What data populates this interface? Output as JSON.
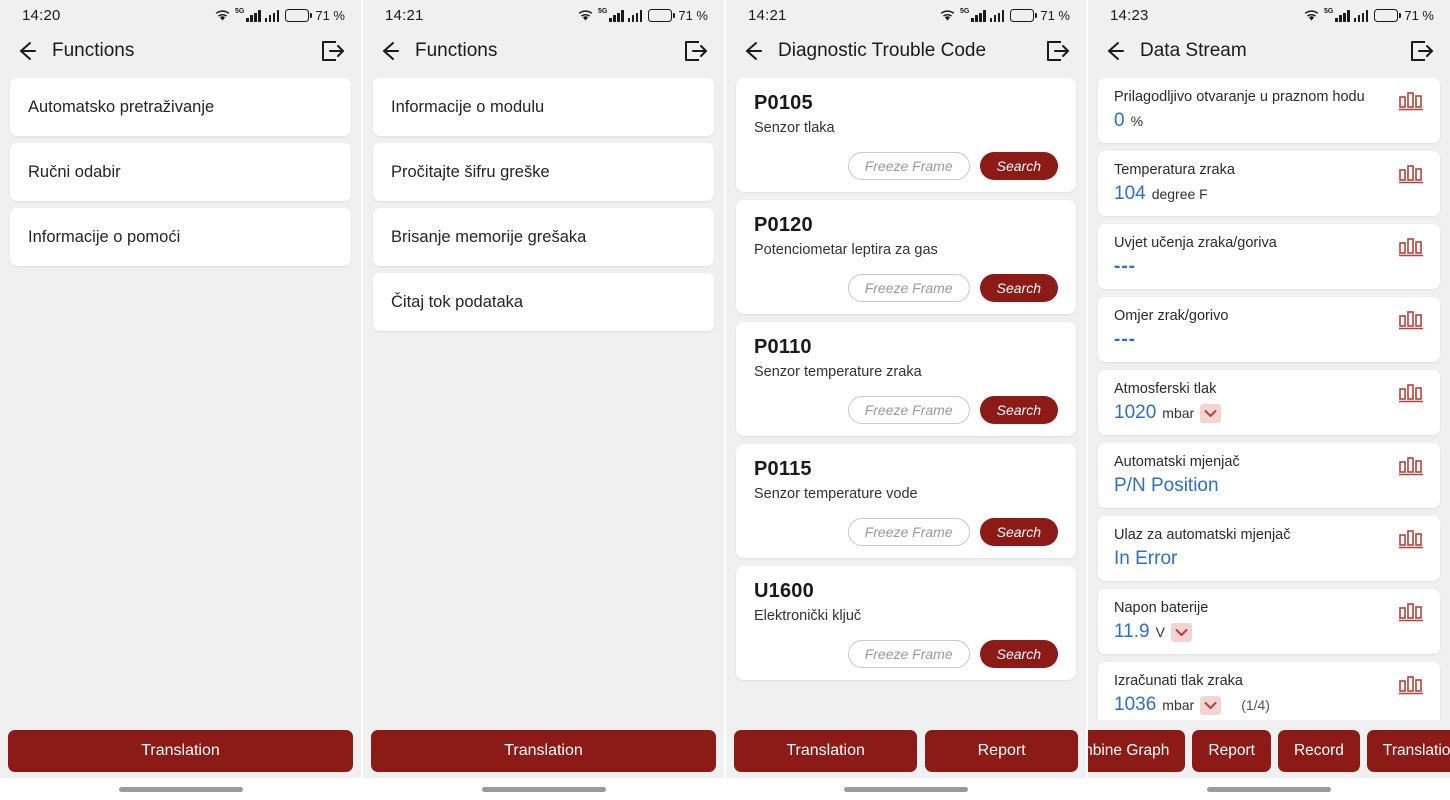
{
  "accent": {
    "red": "#8C1A17",
    "blue": "#2F6FC0",
    "chip_bg": "#F4D3D3",
    "card_bg": "#FFFFFF",
    "screen_bg": "#F0F0F0"
  },
  "panels": [
    {
      "status": {
        "time": "14:20",
        "battery": "71 %",
        "network": "5G"
      },
      "appbar": {
        "title": "Functions",
        "back_icon": "back-arrow-icon",
        "exit_icon": "exit-icon"
      },
      "items": [
        {
          "label": "Automatsko pretraživanje"
        },
        {
          "label": "Ručni odabir"
        },
        {
          "label": "Informacije o pomoći"
        }
      ],
      "buttons": [
        {
          "label": "Translation"
        }
      ]
    },
    {
      "status": {
        "time": "14:21",
        "battery": "71 %",
        "network": "5G"
      },
      "appbar": {
        "title": "Functions",
        "back_icon": "back-arrow-icon",
        "exit_icon": "exit-icon"
      },
      "items": [
        {
          "label": "Informacije o modulu"
        },
        {
          "label": "Pročitajte šifru greške"
        },
        {
          "label": "Brisanje memorije grešaka"
        },
        {
          "label": "Čitaj tok podataka"
        }
      ],
      "buttons": [
        {
          "label": "Translation"
        }
      ]
    },
    {
      "status": {
        "time": "14:21",
        "battery": "71 %",
        "network": "5G"
      },
      "appbar": {
        "title": "Diagnostic Trouble Code",
        "back_icon": "back-arrow-icon",
        "exit_icon": "exit-icon"
      },
      "freeze_label": "Freeze Frame",
      "search_label": "Search",
      "codes": [
        {
          "code": "P0105",
          "desc": "Senzor tlaka"
        },
        {
          "code": "P0120",
          "desc": "Potenciometar leptira za gas"
        },
        {
          "code": "P0110",
          "desc": "Senzor temperature zraka"
        },
        {
          "code": "P0115",
          "desc": "Senzor temperature vode"
        },
        {
          "code": "U1600",
          "desc": "Elektronički ključ"
        }
      ],
      "buttons": [
        {
          "label": "Translation"
        },
        {
          "label": "Report"
        }
      ]
    },
    {
      "status": {
        "time": "14:23",
        "battery": "71 %",
        "network": "5G"
      },
      "appbar": {
        "title": "Data Stream",
        "back_icon": "back-arrow-icon",
        "exit_icon": "exit-icon"
      },
      "page_indicator": "(1/4)",
      "streams": [
        {
          "label": "Prilagodljivo otvaranje u praznom hodu",
          "value": "0",
          "unit": "%",
          "chevron": false,
          "page": ""
        },
        {
          "label": "Temperatura zraka",
          "value": "104",
          "unit": "degree F",
          "chevron": false,
          "page": ""
        },
        {
          "label": "Uvjet učenja zraka/goriva",
          "value": "---",
          "unit": "",
          "chevron": false,
          "page": ""
        },
        {
          "label": "Omjer zrak/gorivo",
          "value": "---",
          "unit": "",
          "chevron": false,
          "page": ""
        },
        {
          "label": "Atmosferski tlak",
          "value": "1020",
          "unit": "mbar",
          "chevron": true,
          "page": ""
        },
        {
          "label": "Automatski mjenjač",
          "value": "P/N Position",
          "unit": "",
          "chevron": false,
          "page": ""
        },
        {
          "label": "Ulaz za automatski mjenjač",
          "value": "In Error",
          "unit": "",
          "chevron": false,
          "page": ""
        },
        {
          "label": "Napon baterije",
          "value": "11.9",
          "unit": "V",
          "chevron": true,
          "page": ""
        },
        {
          "label": "Izračunati tlak zraka",
          "value": "1036",
          "unit": "mbar",
          "chevron": true,
          "page": "(1/4)"
        }
      ],
      "buttons": [
        {
          "label": "Combine Graph"
        },
        {
          "label": "Report"
        },
        {
          "label": "Record"
        },
        {
          "label": "Translation"
        }
      ]
    }
  ]
}
